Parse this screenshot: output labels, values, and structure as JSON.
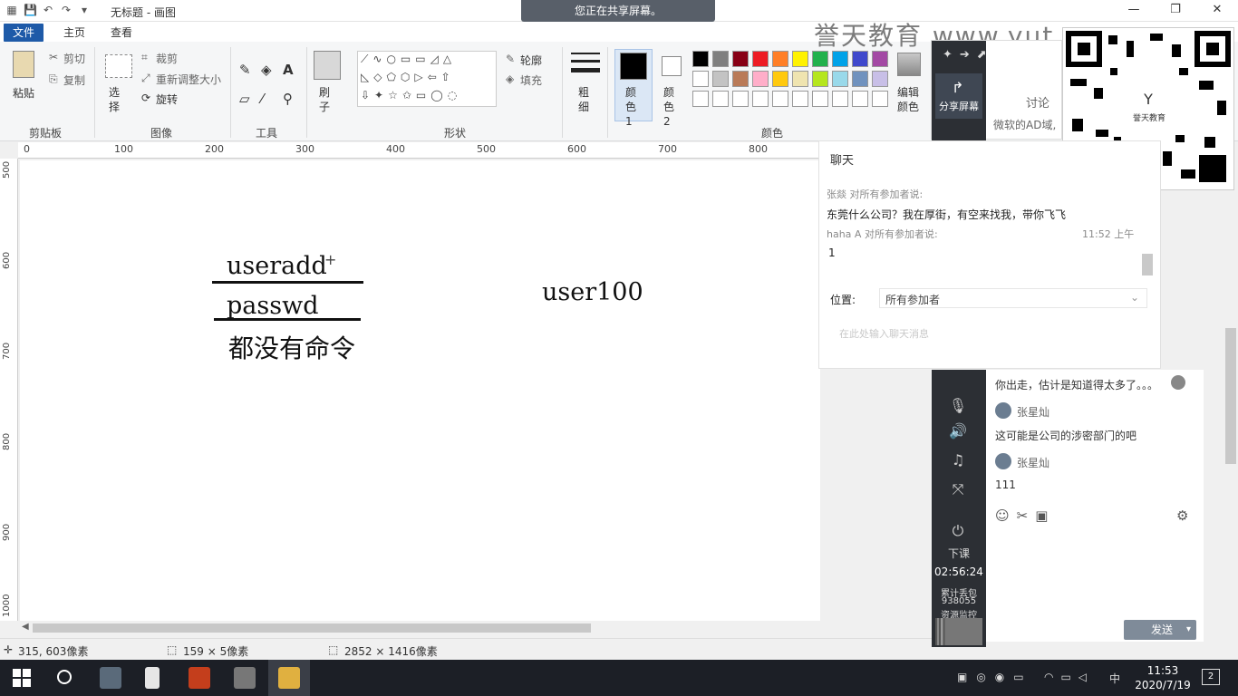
{
  "window": {
    "title": "无标题 - 画图",
    "share_banner": "您正在共享屏幕。",
    "controls": [
      "—",
      "❐",
      "✕"
    ]
  },
  "ribbon": {
    "tabs": [
      "文件",
      "主页",
      "查看"
    ],
    "clipboard": {
      "paste": "粘贴",
      "cut": "剪切",
      "copy": "复制",
      "label": "剪贴板"
    },
    "image": {
      "select": "选择",
      "crop": "裁剪",
      "resize": "重新调整大小",
      "rotate": "旋转",
      "label": "图像"
    },
    "tools": {
      "label": "工具"
    },
    "brush": {
      "label": "刷子"
    },
    "shapes": {
      "outline": "轮廓",
      "fill": "填充",
      "label": "形状"
    },
    "size": {
      "label": "粗细"
    },
    "color1": "颜色 1",
    "color2": "颜色 2",
    "edit_colors": "编辑颜色",
    "colors_label": "颜色",
    "palette_row1": [
      "#000000",
      "#7f7f7f",
      "#880015",
      "#ed1c24",
      "#ff7f27",
      "#fff200",
      "#22b14c",
      "#00a2e8",
      "#3f48cc",
      "#a349a4"
    ],
    "palette_row2": [
      "#ffffff",
      "#c3c3c3",
      "#b97a57",
      "#ffaec9",
      "#ffc90e",
      "#efe4b0",
      "#b5e61d",
      "#99d9ea",
      "#7092be",
      "#c8bfe7"
    ]
  },
  "ruler": {
    "top": [
      "0",
      "100",
      "200",
      "300",
      "400",
      "500",
      "600",
      "700",
      "800"
    ],
    "left": [
      "500",
      "600",
      "700",
      "800",
      "900",
      "1000"
    ]
  },
  "canvas": {
    "line1": "useradd",
    "line2": "passwd",
    "line3": "都没有命令",
    "right_text": "user100"
  },
  "status": {
    "cursor": "315, 603像素",
    "selection": "159 × 5像素",
    "image_size": "2852 × 1416像素"
  },
  "watermark": {
    "brand": "誉天教育 www.yut",
    "qr_caption": "誉天教育"
  },
  "chat": {
    "title": "聊天",
    "msg1_from": "张燚 对所有参加者说:",
    "msg1_text": "东莞什么公司？我在厚街，有空来找我，带你飞飞",
    "msg2_from": "haha A 对所有参加者说:",
    "msg2_time": "11:52 上午",
    "msg2_text": "1",
    "location_label": "位置:",
    "location_value": "所有参加者",
    "input_placeholder": "在此处输入聊天消息"
  },
  "share_toolbar": {
    "share_screen": "分享屏幕",
    "discuss": "讨论",
    "discuss_sub": "微软的AD域,"
  },
  "side_panel": {
    "end_class": "下课",
    "timer": "02:56:24",
    "stats_line1": "累计丢包",
    "stats_line2": "938055",
    "stats_line3": "资源监控"
  },
  "chat2": {
    "line1": "你出走，估计是知道得太多了。。。",
    "name1": "张星灿",
    "line2": "这可能是公司的涉密部门的吧",
    "name2": "张星灿",
    "line3": "111",
    "send": "发送"
  },
  "taskbar": {
    "time": "11:53",
    "date": "2020/7/19",
    "ime": "中"
  }
}
